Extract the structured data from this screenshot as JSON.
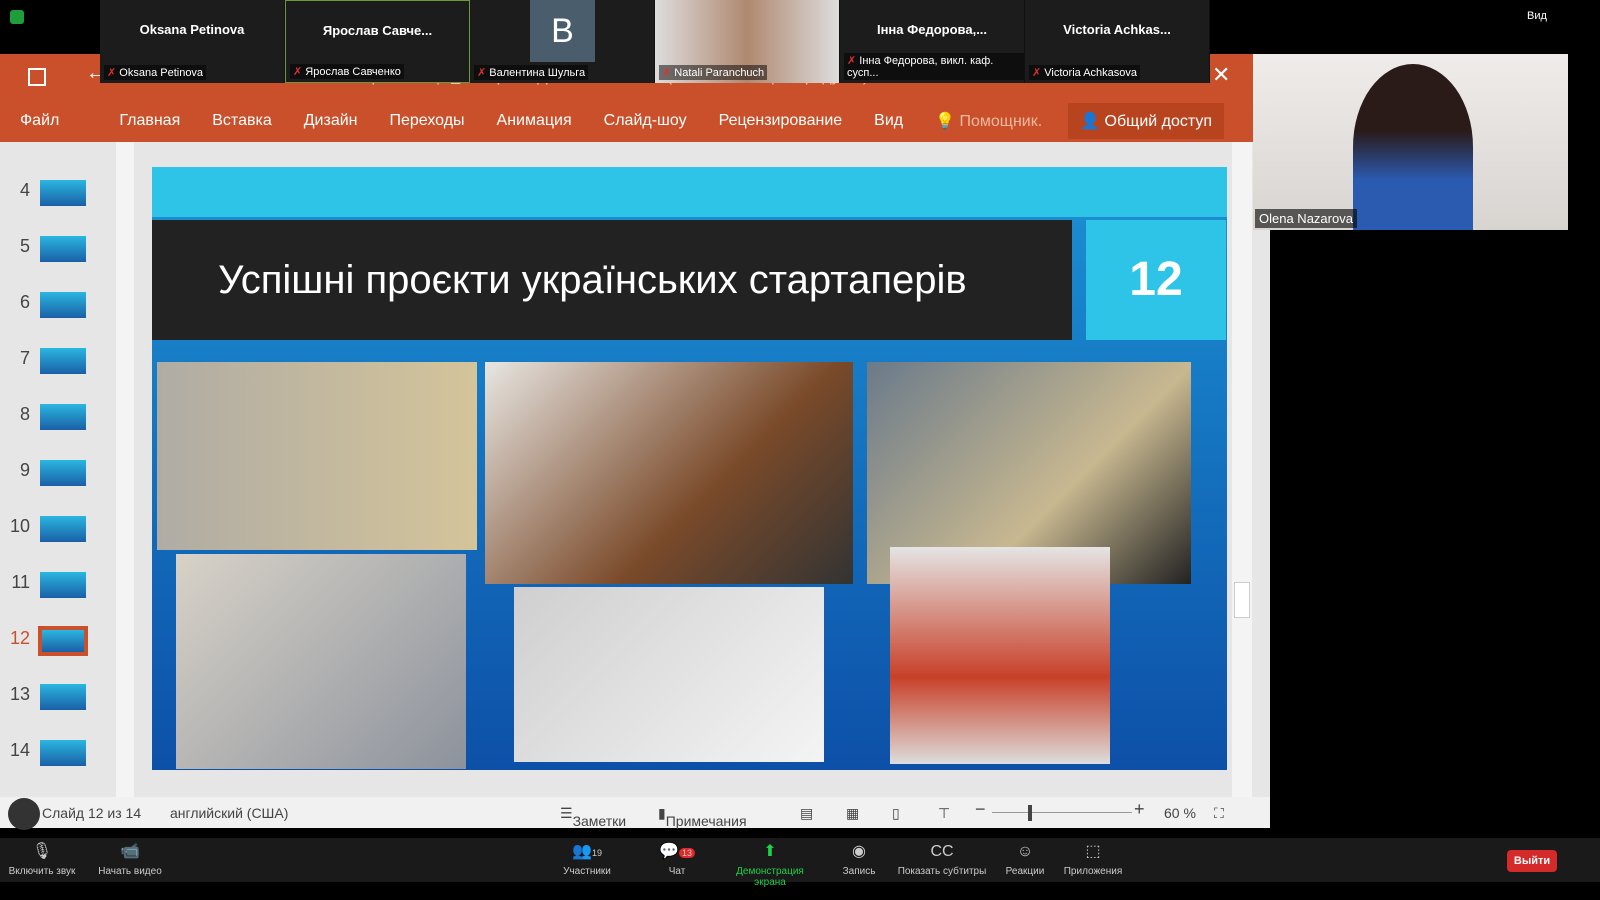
{
  "top": {
    "view_label": "Вид"
  },
  "participants": [
    {
      "display": "Oksana Petinova",
      "label": "Oksana Petinova"
    },
    {
      "display": "Ярослав  Савче...",
      "label": "Ярослав Савченко"
    },
    {
      "display": "B",
      "label": "Валентина Шульга"
    },
    {
      "display": "",
      "label": "Natali Paranchuch"
    },
    {
      "display": "Інна  Федорова,...",
      "label": "Інна Федорова, викл. каф. сусп..."
    },
    {
      "display": "Victoria  Achkas...",
      "label": "Victoria Achkasova"
    }
  ],
  "speaker": {
    "name": "Olena Nazarova"
  },
  "ppt": {
    "title": "Презентація_Назарова.pptx - PowerPoint (Сбой активации продукта)",
    "tabs": [
      "Файл",
      "Главная",
      "Вставка",
      "Дизайн",
      "Переходы",
      "Анимация",
      "Слайд-шоу",
      "Рецензирование",
      "Вид",
      "Помощник.",
      "Общий доступ"
    ],
    "thumbs": [
      "4",
      "5",
      "6",
      "7",
      "8",
      "9",
      "10",
      "11",
      "12",
      "13",
      "14"
    ],
    "selected": "12",
    "slide": {
      "title": "Успішні проєкти українських стартаперів",
      "number": "12"
    },
    "status": {
      "slide": "Слайд 12 из 14",
      "lang": "английский (США)",
      "notes": "Заметки",
      "comments": "Примечания",
      "zoom": "60 %"
    }
  },
  "toolbar": [
    {
      "icon": "mic-off-icon",
      "label": "Включить звук"
    },
    {
      "icon": "video-off-icon",
      "label": "Начать видео"
    },
    {
      "icon": "participants-icon",
      "label": "Участники",
      "count": "19"
    },
    {
      "icon": "chat-icon",
      "label": "Чат",
      "badge": "13"
    },
    {
      "icon": "share-screen-icon",
      "label": "Демонстрация экрана"
    },
    {
      "icon": "record-icon",
      "label": "Запись"
    },
    {
      "icon": "cc-icon",
      "label": "Показать субтитры"
    },
    {
      "icon": "reactions-icon",
      "label": "Реакции"
    },
    {
      "icon": "apps-icon",
      "label": "Приложения"
    }
  ],
  "leave": "Выйти"
}
